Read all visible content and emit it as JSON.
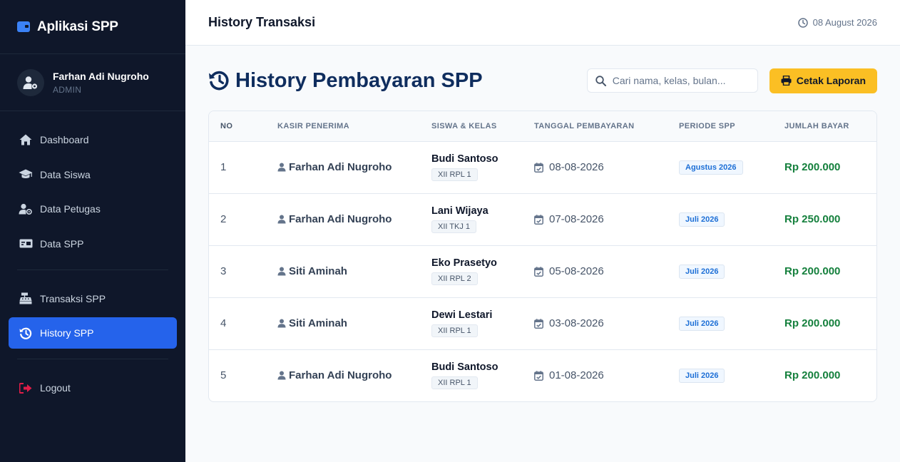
{
  "app": {
    "name": "Aplikasi SPP"
  },
  "user": {
    "name": "Farhan Adi Nugroho",
    "role": "ADMIN"
  },
  "nav": {
    "items": [
      {
        "label": "Dashboard",
        "icon": "home-icon"
      },
      {
        "label": "Data Siswa",
        "icon": "graduation-cap-icon"
      },
      {
        "label": "Data Petugas",
        "icon": "user-cog-icon"
      },
      {
        "label": "Data SPP",
        "icon": "money-bill-icon"
      }
    ],
    "transaksi": "Transaksi SPP",
    "history": "History SPP",
    "logout": "Logout"
  },
  "topbar": {
    "title": "History Transaksi",
    "date": "08 August 2026"
  },
  "page": {
    "title": "History Pembayaran SPP",
    "search_placeholder": "Cari nama, kelas, bulan...",
    "print_label": "Cetak Laporan"
  },
  "table": {
    "headers": [
      "NO",
      "KASIR PENERIMA",
      "SISWA & KELAS",
      "TANGGAL PEMBAYARAN",
      "PERIODE SPP",
      "JUMLAH BAYAR"
    ],
    "rows": [
      {
        "no": "1",
        "kasir": "Farhan Adi Nugroho",
        "siswa": "Budi Santoso",
        "kelas": "XII RPL 1",
        "tanggal": "08-08-2026",
        "periode": "Agustus 2026",
        "jumlah": "Rp 200.000"
      },
      {
        "no": "2",
        "kasir": "Farhan Adi Nugroho",
        "siswa": "Lani Wijaya",
        "kelas": "XII TKJ 1",
        "tanggal": "07-08-2026",
        "periode": "Juli 2026",
        "jumlah": "Rp 250.000"
      },
      {
        "no": "3",
        "kasir": "Siti Aminah",
        "siswa": "Eko Prasetyo",
        "kelas": "XII RPL 2",
        "tanggal": "05-08-2026",
        "periode": "Juli 2026",
        "jumlah": "Rp 200.000"
      },
      {
        "no": "4",
        "kasir": "Siti Aminah",
        "siswa": "Dewi Lestari",
        "kelas": "XII RPL 1",
        "tanggal": "03-08-2026",
        "periode": "Juli 2026",
        "jumlah": "Rp 200.000"
      },
      {
        "no": "5",
        "kasir": "Farhan Adi Nugroho",
        "siswa": "Budi Santoso",
        "kelas": "XII RPL 1",
        "tanggal": "01-08-2026",
        "periode": "Juli 2026",
        "jumlah": "Rp 200.000"
      }
    ]
  },
  "colors": {
    "sidebar": "#0f172a",
    "accent": "#2563eb",
    "print_button": "#fbbf24",
    "amount": "#15803d",
    "title": "#0f2d5e"
  }
}
